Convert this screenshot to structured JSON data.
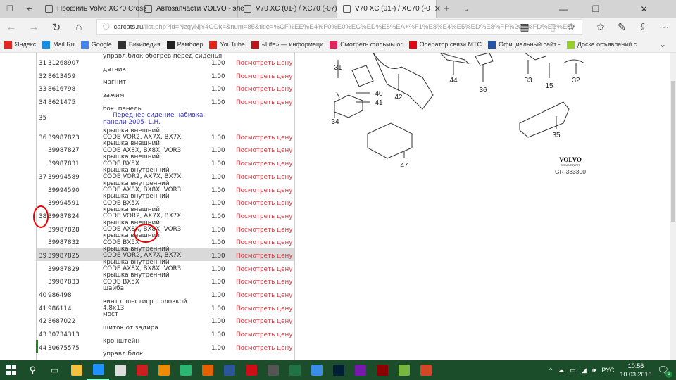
{
  "browser": {
    "tabs": [
      {
        "label": "Профиль Volvo XC70 Cross",
        "icon": "edge-site-icon"
      },
      {
        "label": "Автозапчасти VOLVO - эле",
        "icon": "page-icon"
      },
      {
        "label": "V70 XC (01-) / XC70 (-07), 2",
        "icon": "book-icon"
      },
      {
        "label": "V70 XC (01-) / XC70 (-0",
        "icon": "book-icon",
        "active": true
      }
    ],
    "url_domain": "carcats.ru",
    "url_path": "/list.php?id=NzgyNjY4ODk=&num=85&title=%CF%EE%E4%F0%E0%EC%ED%E8%EA+%F1%E8%E4%E5%ED%E8%FF%2C+%FD%EB%E59",
    "favorites": [
      {
        "label": "Яндекс",
        "icon": "yandex-icon",
        "color": "#e52620"
      },
      {
        "label": "Mail Ru",
        "icon": "mailru-icon",
        "color": "#168de2"
      },
      {
        "label": "Google",
        "icon": "google-icon",
        "color": "#4285f4"
      },
      {
        "label": "Википедия",
        "icon": "wikipedia-icon",
        "color": "#333333"
      },
      {
        "label": "Рамблер",
        "icon": "home-icon",
        "color": "#222222"
      },
      {
        "label": "YouTube",
        "icon": "youtube-icon",
        "color": "#e62117"
      },
      {
        "label": "«Life» — информаци",
        "icon": "life-icon",
        "color": "#c0101a"
      },
      {
        "label": "Смотреть фильмы ог",
        "icon": "ivi-icon",
        "color": "#e0245e"
      },
      {
        "label": "Оператор связи МТС",
        "icon": "mts-icon",
        "color": "#e30611"
      },
      {
        "label": "Официальный сайт -",
        "icon": "aeroflot-icon",
        "color": "#2255aa"
      },
      {
        "label": "Доска объявлений с",
        "icon": "avito-icon",
        "color": "#97cf26"
      }
    ]
  },
  "parts": {
    "price_link": "Посмотреть цену",
    "rows": [
      {
        "num": "31",
        "pn": "31268907",
        "desc": "управл.блок обогрев перед.сиденья",
        "qty": "1.00"
      },
      {
        "num": "32",
        "pn": "8613459",
        "desc": "датчик",
        "qty": "1.00"
      },
      {
        "num": "33",
        "pn": "8616798",
        "desc": "магнит",
        "qty": "1.00"
      },
      {
        "num": "34",
        "pn": "8621475",
        "desc": "зажим",
        "qty": "1.00"
      },
      {
        "num": "35",
        "pn": "",
        "desc": "бок. панель",
        "sub1": "Переднее сидение набивка,",
        "sub2": "панели 2005- L.H.",
        "qty": ""
      },
      {
        "num": "36",
        "pn": "39987823",
        "desc": "крышка внешний",
        "code": "CODE VOR2, AX7X, BX7X",
        "qty": "1.00"
      },
      {
        "num": "",
        "pn": "39987827",
        "desc": "крышка внешний",
        "code": "CODE AX8X, BX8X, VOR3",
        "qty": "1.00"
      },
      {
        "num": "",
        "pn": "39987831",
        "desc": "крышка внешний",
        "code": "CODE BX5X",
        "qty": "1.00"
      },
      {
        "num": "37",
        "pn": "39994589",
        "desc": "крышка внутренний",
        "code": "CODE VOR2, AX7X, BX7X",
        "qty": "1.00"
      },
      {
        "num": "",
        "pn": "39994590",
        "desc": "крышка внутренний",
        "code": "CODE AX8X, BX8X, VOR3",
        "qty": "1.00"
      },
      {
        "num": "",
        "pn": "39994591",
        "desc": "крышка внутренний",
        "code": "CODE BX5X",
        "qty": "1.00"
      },
      {
        "num": "38",
        "pn": "39987824",
        "desc": "крышка внешний",
        "code": "CODE VOR2, AX7X, BX7X",
        "qty": "1.00"
      },
      {
        "num": "",
        "pn": "39987828",
        "desc": "крышка внешний",
        "code": "CODE AX8X, BX8X, VOR3",
        "qty": "1.00"
      },
      {
        "num": "",
        "pn": "39987832",
        "desc": "крышка внешний",
        "code": "CODE BX5X",
        "qty": "1.00"
      },
      {
        "num": "39",
        "pn": "39987825",
        "desc": "крышка внутренний",
        "code": "CODE VOR2, AX7X, BX7X",
        "qty": "1.00",
        "highlight": true
      },
      {
        "num": "",
        "pn": "39987829",
        "desc": "крышка внутренний",
        "code": "CODE AX8X, BX8X, VOR3",
        "qty": "1.00"
      },
      {
        "num": "",
        "pn": "39987833",
        "desc": "крышка внутренний",
        "code": "CODE BX5X",
        "qty": "1.00"
      },
      {
        "num": "40",
        "pn": "986498",
        "desc": "шайба",
        "qty": "1.00"
      },
      {
        "num": "41",
        "pn": "986114",
        "desc": "винт с шестигр. головкой",
        "code": "4.8x13",
        "qty": "1.00"
      },
      {
        "num": "42",
        "pn": "8687022",
        "desc": "мост",
        "qty": "1.00"
      },
      {
        "num": "43",
        "pn": "30734313",
        "desc": "щиток от задира",
        "qty": "1.00"
      },
      {
        "num": "44",
        "pn": "30675575",
        "desc": "кронштейн",
        "qty": "1.00"
      },
      {
        "num": "",
        "pn": "",
        "desc": "управл.блок",
        "qty": ""
      }
    ]
  },
  "diagram": {
    "callouts": [
      "31",
      "40",
      "41",
      "34",
      "42",
      "44",
      "36",
      "33",
      "15",
      "32",
      "35",
      "47"
    ],
    "brand": "VOLVO",
    "brand_sub": "GENUINE PARTS",
    "ref": "GR-383300"
  },
  "taskbar": {
    "apps": [
      {
        "icon": "explorer-icon",
        "color": "#f3c140"
      },
      {
        "icon": "edge-icon",
        "color": "#1e90ff",
        "active": true
      },
      {
        "icon": "mail-icon",
        "color": "#dddddd"
      },
      {
        "icon": "acrobat-icon",
        "color": "#cc1f1f"
      },
      {
        "icon": "vlc-icon",
        "color": "#f08a00"
      },
      {
        "icon": "plus-app-icon",
        "color": "#2bb673"
      },
      {
        "icon": "firefox-icon",
        "color": "#e66000"
      },
      {
        "icon": "word-icon",
        "color": "#2b579a"
      },
      {
        "icon": "opera-icon",
        "color": "#cc0f16"
      },
      {
        "icon": "calculator-icon",
        "color": "#555555"
      },
      {
        "icon": "excel-icon",
        "color": "#217346"
      },
      {
        "icon": "droplet-icon",
        "color": "#3a8ee6"
      },
      {
        "icon": "photoshop-icon",
        "color": "#001e36"
      },
      {
        "icon": "onenote-icon",
        "color": "#7719aa"
      },
      {
        "icon": "res-icon",
        "color": "#8b0000"
      },
      {
        "icon": "utorrent-icon",
        "color": "#76b83f"
      },
      {
        "icon": "powerpoint-icon",
        "color": "#d24726"
      }
    ],
    "lang": "РУС",
    "time": "10:56",
    "date": "10.03.2018",
    "notifications": "1"
  }
}
